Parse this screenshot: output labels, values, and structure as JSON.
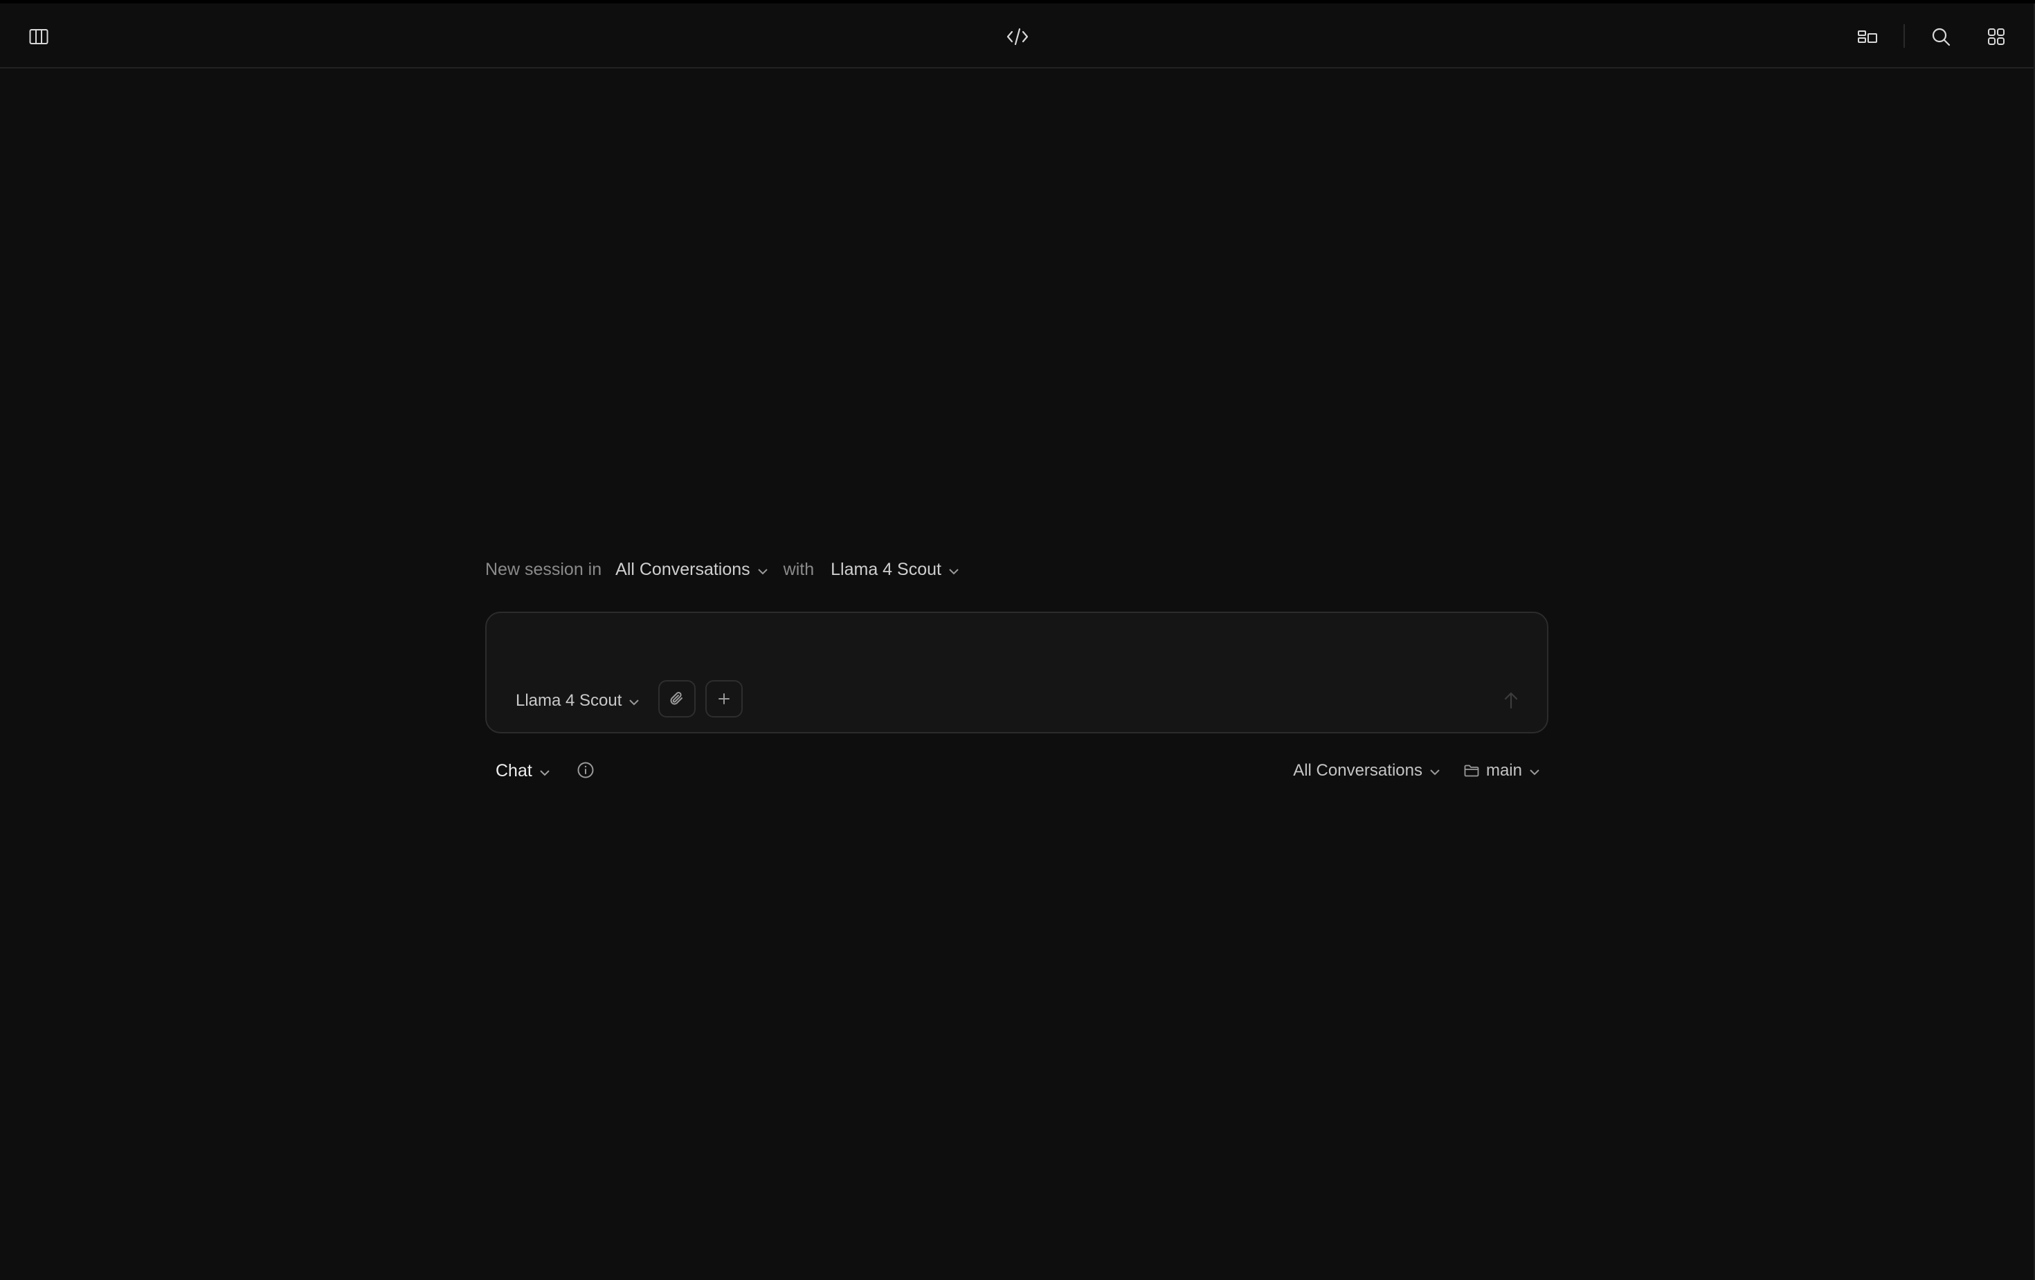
{
  "topbar": {
    "left_icon": "sidebar-columns-icon",
    "center_icon": "code-icon",
    "right_icons": [
      "layout-panels-icon",
      "search-icon",
      "apps-grid-icon"
    ]
  },
  "session_header": {
    "prefix": "New session in",
    "project": "All Conversations",
    "with_label": "with",
    "model": "Llama 4 Scout"
  },
  "composer": {
    "placeholder": "",
    "model": "Llama 4 Scout",
    "attach_icon": "paperclip-icon",
    "add_icon": "plus-icon",
    "send_icon": "arrow-up-icon"
  },
  "footer": {
    "mode": "Chat",
    "info_icon": "info-icon",
    "project": "All Conversations",
    "branch": "main"
  },
  "colors": {
    "background": "#0e0e0e",
    "composer_bg": "#151515",
    "border": "#2c2c2c",
    "text": "#d6d6d6",
    "muted": "#8a8a8a"
  }
}
